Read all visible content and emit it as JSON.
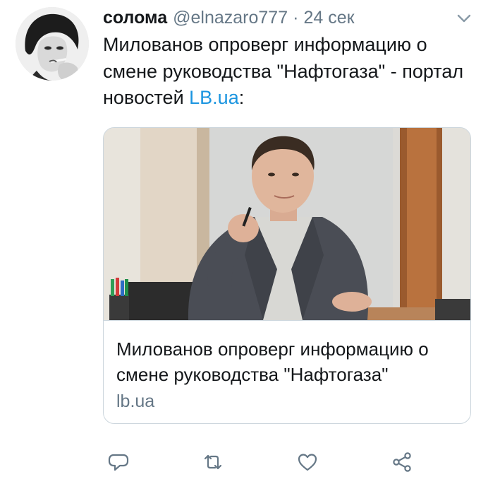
{
  "tweet": {
    "display_name": "солома",
    "handle": "@elnazaro777",
    "separator": "·",
    "time": "24 сек",
    "text_before_link": "Милованов опроверг информацию о смене руководства \"Нафтогаза\" - портал новостей ",
    "link_text": "LB.ua",
    "text_after_link": ":"
  },
  "card": {
    "title": "Милованов опроверг информацию о смене руководства \"Нафтогаза\"",
    "domain": "lb.ua"
  },
  "icons": {
    "avatar": "profile-photo",
    "caret": "chevron-down-icon",
    "reply": "reply-icon",
    "retweet": "retweet-icon",
    "like": "heart-icon",
    "share": "share-icon"
  },
  "colors": {
    "text": "#14171a",
    "secondary": "#657786",
    "link": "#1b95e0",
    "border": "#ccd6dd"
  }
}
